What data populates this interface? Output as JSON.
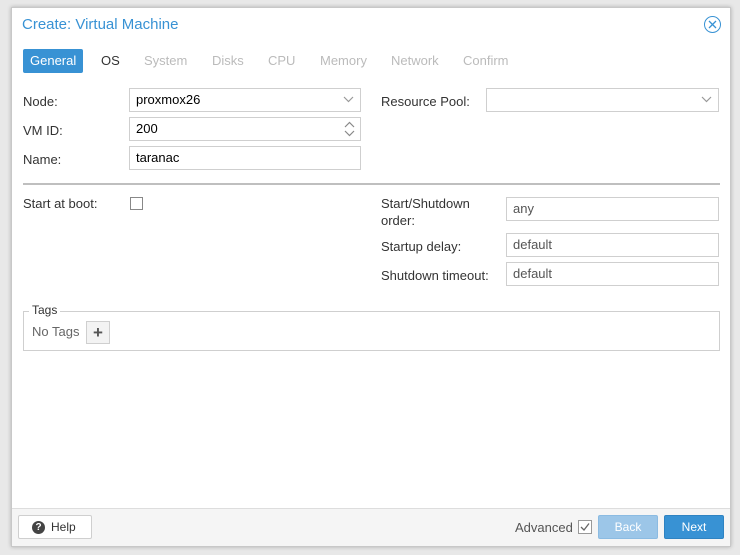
{
  "window": {
    "title": "Create: Virtual Machine"
  },
  "tabs": [
    {
      "label": "General",
      "state": "active"
    },
    {
      "label": "OS",
      "state": "enabled"
    },
    {
      "label": "System",
      "state": "disabled"
    },
    {
      "label": "Disks",
      "state": "disabled"
    },
    {
      "label": "CPU",
      "state": "disabled"
    },
    {
      "label": "Memory",
      "state": "disabled"
    },
    {
      "label": "Network",
      "state": "disabled"
    },
    {
      "label": "Confirm",
      "state": "disabled"
    }
  ],
  "form": {
    "node_label": "Node:",
    "node_value": "proxmox26",
    "vmid_label": "VM ID:",
    "vmid_value": "200",
    "name_label": "Name:",
    "name_value": "taranac",
    "resource_pool_label": "Resource Pool:",
    "resource_pool_value": "",
    "start_at_boot_label": "Start at boot:",
    "start_at_boot_checked": false,
    "startup_order_label_line1": "Start/Shutdown",
    "startup_order_label_line2": "order:",
    "startup_order_value": "any",
    "startup_delay_label": "Startup delay:",
    "startup_delay_value": "default",
    "shutdown_timeout_label": "Shutdown timeout:",
    "shutdown_timeout_value": "default"
  },
  "tags": {
    "legend": "Tags",
    "empty_text": "No Tags",
    "add_icon": "plus-icon"
  },
  "footer": {
    "help_label": "Help",
    "help_icon": "question-circle-icon",
    "advanced_label": "Advanced",
    "advanced_checked": true,
    "back_label": "Back",
    "next_label": "Next"
  },
  "colors": {
    "accent": "#3892d4",
    "accent_disabled": "#9cc6e8"
  }
}
